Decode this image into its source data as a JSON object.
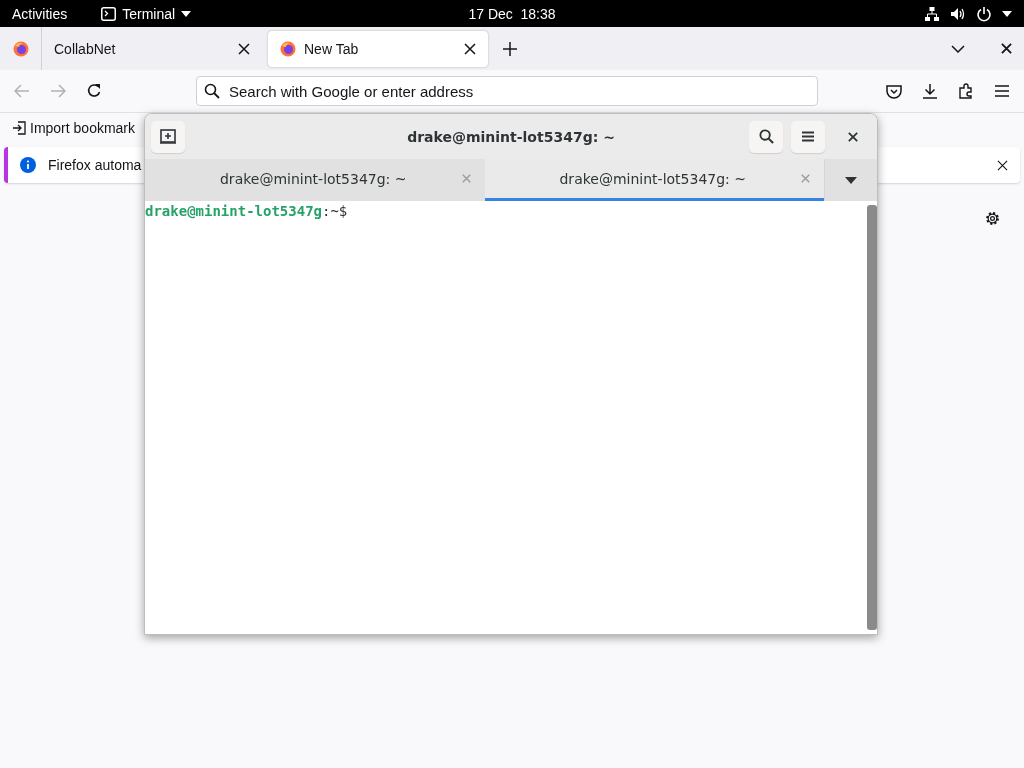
{
  "topbar": {
    "activities": "Activities",
    "app": "Terminal",
    "clock": "17 Dec  18:38"
  },
  "browser": {
    "tabs": [
      {
        "label": "CollabNet",
        "selected": false
      },
      {
        "label": "New Tab",
        "selected": true
      }
    ],
    "address": {
      "placeholder": "Search with Google or enter address"
    },
    "bookmarks": [
      "Import bookmark"
    ],
    "notification": {
      "text": "Firefox automa"
    }
  },
  "terminal": {
    "title": "drake@minint-lot5347g: ~",
    "tabs": [
      {
        "label": "drake@minint-lot5347g: ~",
        "selected": false
      },
      {
        "label": "drake@minint-lot5347g: ~",
        "selected": true
      }
    ],
    "prompt": {
      "user_host": "drake@minint-lot5347g",
      "suffix": ":~$"
    }
  }
}
